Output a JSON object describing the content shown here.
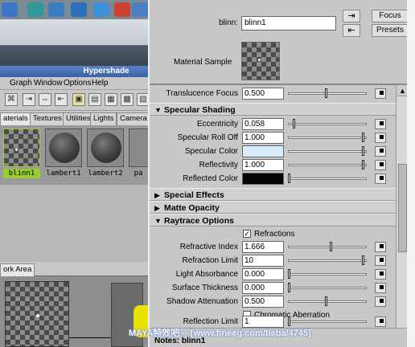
{
  "hypershade": {
    "title": "Hypershade",
    "menus": [
      "Graph",
      "Window",
      "Options",
      "Help"
    ],
    "tabs": [
      "aterials",
      "Textures",
      "Utilities",
      "Lights",
      "Camera"
    ],
    "swatches": [
      {
        "label": "blinn1"
      },
      {
        "label": "lambert1"
      },
      {
        "label": "lambert2"
      },
      {
        "label": "pa"
      }
    ],
    "work_area_tab": "ork Area"
  },
  "attribute_editor": {
    "node_name_label": "blinn:",
    "node_name_value": "blinn1",
    "focus_button": "Focus",
    "presets_button": "Presets",
    "material_sample_label": "Material Sample",
    "translucence_focus": {
      "label": "Translucence Focus",
      "value": "0.500",
      "slider": 0.5
    },
    "specular_section": "Specular Shading",
    "specular": [
      {
        "label": "Eccentricity",
        "value": "0.058",
        "slider": 0.06
      },
      {
        "label": "Specular Roll Off",
        "value": "1.000",
        "slider": 1.0
      },
      {
        "label": "Specular Color",
        "color": "#d6eefc",
        "slider": 1.0
      },
      {
        "label": "Reflectivity",
        "value": "1.000",
        "slider": 1.0
      },
      {
        "label": "Reflected Color",
        "color": "#050505",
        "slider": 0.0
      }
    ],
    "special_effects_section": "Special Effects",
    "matte_opacity_section": "Matte Opacity",
    "raytrace_section": "Raytrace Options",
    "refractions_label": "Refractions",
    "raytrace": [
      {
        "label": "Refractive Index",
        "value": "1.666",
        "slider": 0.56
      },
      {
        "label": "Refraction Limit",
        "value": "10",
        "slider": 1.0
      },
      {
        "label": "Light Absorbance",
        "value": "0.000",
        "slider": 0.0
      },
      {
        "label": "Surface Thickness",
        "value": "0.000",
        "slider": 0.0
      },
      {
        "label": "Shadow Attenuation",
        "value": "0.500",
        "slider": 0.5
      }
    ],
    "chromatic_label": "Chromatic Aberration",
    "reflection_limit": {
      "label": "Reflection Limit",
      "value": "1",
      "slider": 0.0
    },
    "notes_label": "Notes: blinn1"
  },
  "watermark": "MAYA特效吧 -- [www.fineeg.com/tieba/4745]"
}
